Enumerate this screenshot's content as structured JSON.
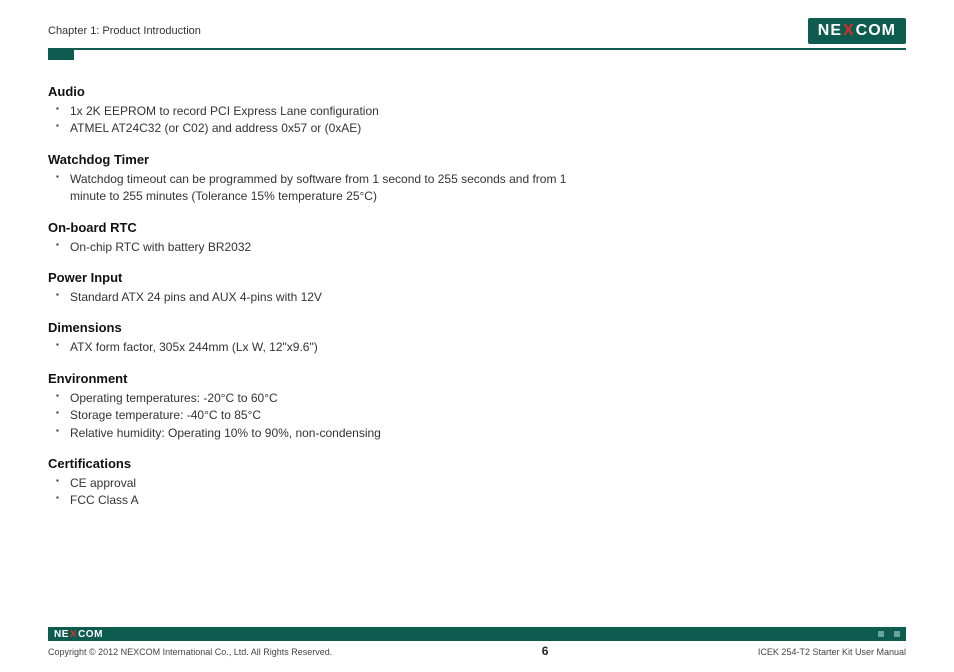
{
  "header": {
    "chapter": "Chapter 1: Product Introduction",
    "brand_pre": "NE",
    "brand_x": "X",
    "brand_post": "COM"
  },
  "sections": {
    "audio": {
      "title": "Audio",
      "items": [
        "1x 2K EEPROM to record PCI Express Lane configuration",
        "ATMEL AT24C32 (or C02) and address 0x57 or (0xAE)"
      ]
    },
    "watchdog": {
      "title": "Watchdog Timer",
      "items": [
        "Watchdog timeout can be programmed by software from 1 second to 255 seconds and from 1 minute to 255 minutes (Tolerance 15% temperature 25°C)"
      ]
    },
    "rtc": {
      "title": "On-board RTC",
      "items": [
        "On-chip RTC with battery BR2032"
      ]
    },
    "power": {
      "title": "Power Input",
      "items": [
        "Standard ATX 24 pins and AUX 4-pins with 12V"
      ]
    },
    "dimensions": {
      "title": "Dimensions",
      "items": [
        "ATX form factor, 305x 244mm (Lx W, 12\"x9.6\")"
      ]
    },
    "environment": {
      "title": "Environment",
      "items": [
        "Operating temperatures: -20°C to 60°C",
        "Storage temperature: -40°C to 85°C",
        "Relative humidity: Operating 10% to 90%, non-condensing"
      ]
    },
    "certifications": {
      "title": "Certifications",
      "items": [
        "CE approval",
        "FCC Class A"
      ]
    }
  },
  "footer": {
    "brand_pre": "NE",
    "brand_x": "X",
    "brand_post": "COM",
    "copyright": "Copyright © 2012 NEXCOM International Co., Ltd. All Rights Reserved.",
    "page_number": "6",
    "doc_title": "ICEK 254-T2 Starter Kit User Manual"
  }
}
